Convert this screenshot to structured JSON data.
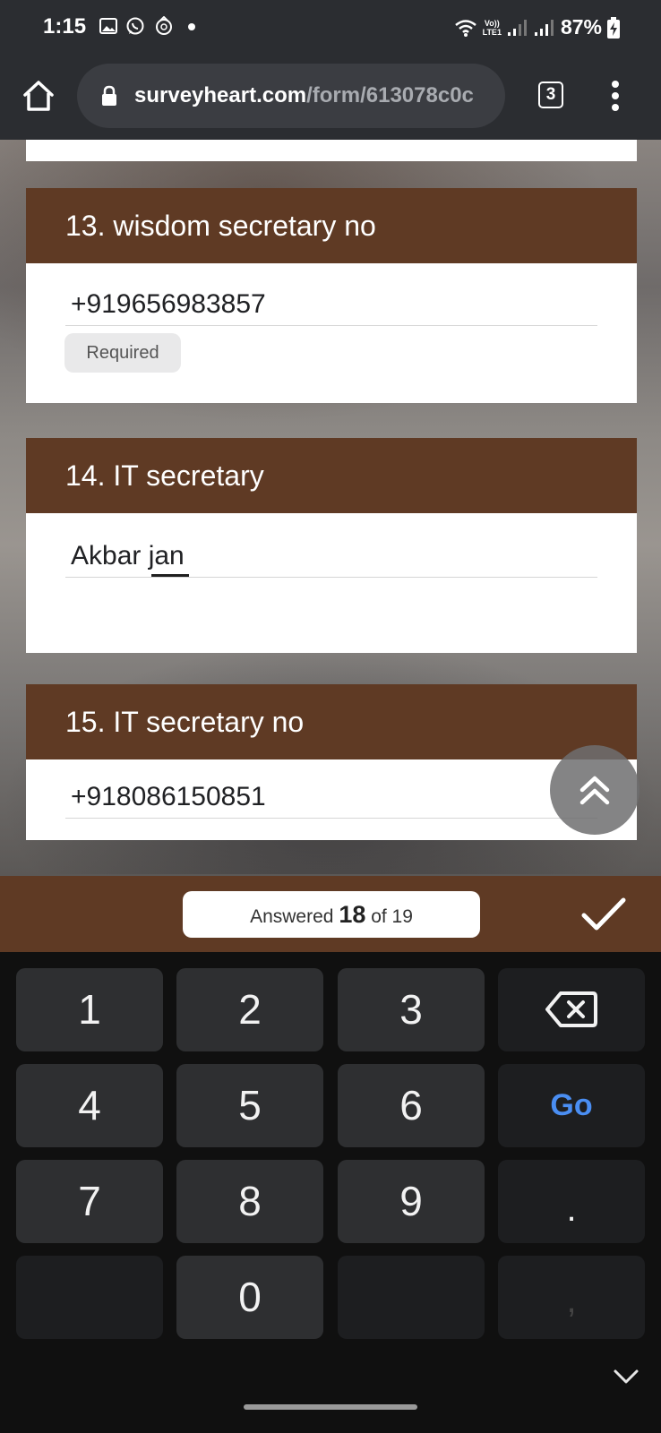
{
  "status_bar": {
    "time": "1:15",
    "network_top": "Vo))",
    "network_bottom": "LTE1",
    "battery": "87%"
  },
  "browser": {
    "url_host": "surveyheart.com",
    "url_path": "/form/613078c0c",
    "tab_count": "3"
  },
  "form": {
    "questions": [
      {
        "number_title": "13. wisdom secretary no",
        "answer": "+919656983857",
        "required_chip": "Required"
      },
      {
        "number_title": "14. IT secretary",
        "answer": "Akbar jan"
      },
      {
        "number_title": "15. IT secretary no",
        "answer": "+918086150851"
      }
    ]
  },
  "progress": {
    "prefix": "Answered",
    "answered": "18",
    "suffix": "of 19",
    "answered_value": 18,
    "total": 19
  },
  "keyboard": {
    "keys": [
      "1",
      "2",
      "3",
      "4",
      "5",
      "6",
      "7",
      "8",
      "9",
      "0"
    ],
    "go_label": "Go",
    "dot_label": ".",
    "comma_label": ","
  },
  "colors": {
    "brand_brown": "#5f3a24",
    "go_blue": "#4a8ef2"
  }
}
